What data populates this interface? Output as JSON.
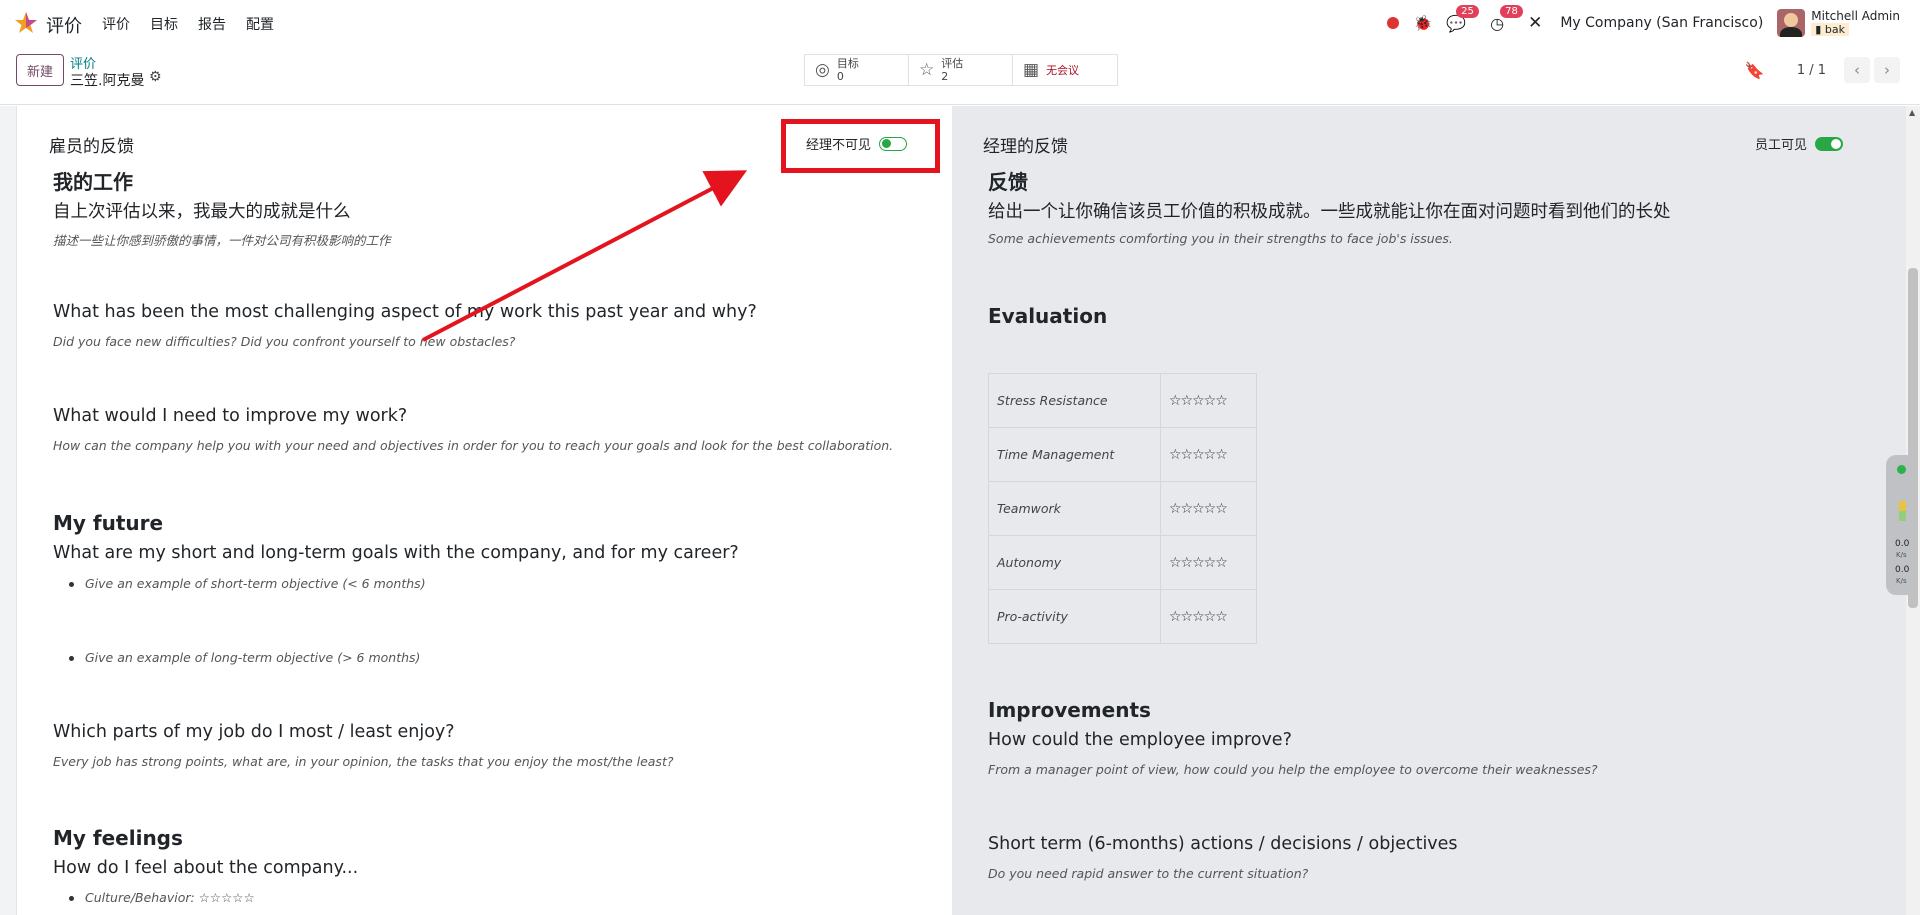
{
  "nav": {
    "app_name": "评价",
    "menu": [
      "评价",
      "目标",
      "报告",
      "配置"
    ],
    "messages_count": "25",
    "activities_count": "78",
    "company": "My Company (San Francisco)",
    "user_name": "Mitchell Admin",
    "db_name": "bak"
  },
  "control": {
    "new_label": "新建",
    "breadcrumb_parent": "评价",
    "breadcrumb_current": "三笠.阿克曼",
    "smart_buttons": [
      {
        "icon": "bullseye-icon",
        "label": "目标",
        "value": "0"
      },
      {
        "icon": "star-half-icon",
        "label": "评估",
        "value": "2"
      },
      {
        "icon": "calendar-icon",
        "label": "无会议"
      }
    ],
    "pager_value": "1 / 1"
  },
  "employee": {
    "title": "雇员的反馈",
    "toggle_label": "经理不可见",
    "toggle_on": false,
    "sec_work": "我的工作",
    "q1": "自上次评估以来，我最大的成就是什么",
    "h1": "描述一些让你感到骄傲的事情，一件对公司有积极影响的工作",
    "q2": "What has been the most challenging aspect of my work this past year and why?",
    "h2": "Did you face new difficulties? Did you confront yourself to new obstacles?",
    "q3": "What would I need to improve my work?",
    "h3": "How can the company help you with your need and objectives in order for you to reach your goals and look for the best collaboration.",
    "sec_future": "My future",
    "q4": "What are my short and long-term goals with the company, and for my career?",
    "b1": "Give an example of short-term objective (< 6 months)",
    "b2": "Give an example of long-term objective (> 6 months)",
    "q5": "Which parts of my job do I most / least enjoy?",
    "h5": "Every job has strong points, what are, in your opinion, the tasks that you enjoy the most/the least?",
    "sec_feel": "My feelings",
    "q6": "How do I feel about the company...",
    "b3": "Culture/Behavior: ☆☆☆☆☆"
  },
  "manager": {
    "title": "经理的反馈",
    "toggle_label": "员工可见",
    "toggle_on": true,
    "sec_feedback": "反馈",
    "q1": "给出一个让你确信该员工价值的积极成就。一些成就能让你在面对问题时看到他们的长处",
    "h1": "Some achievements comforting you in their strengths to face job's issues.",
    "sec_eval": "Evaluation",
    "eval_rows": [
      {
        "label": "Stress Resistance",
        "stars": "☆☆☆☆☆"
      },
      {
        "label": "Time Management",
        "stars": "☆☆☆☆☆"
      },
      {
        "label": "Teamwork",
        "stars": "☆☆☆☆☆"
      },
      {
        "label": "Autonomy",
        "stars": "☆☆☆☆☆"
      },
      {
        "label": "Pro-activity",
        "stars": "☆☆☆☆☆"
      }
    ],
    "sec_improve": "Improvements",
    "q2": "How could the employee improve?",
    "h2": "From a manager point of view, how could you help the employee to overcome their weaknesses?",
    "q3": "Short term (6-months) actions / decisions / objectives",
    "h3": "Do you need rapid answer to the current situation?"
  },
  "netmon": {
    "up": "0.0",
    "down": "0.0",
    "unit": "K/s"
  },
  "colors": {
    "accent": "#714b67",
    "link": "#017e84",
    "toggle_green": "#28a745",
    "highlight_red": "#e4141e"
  }
}
